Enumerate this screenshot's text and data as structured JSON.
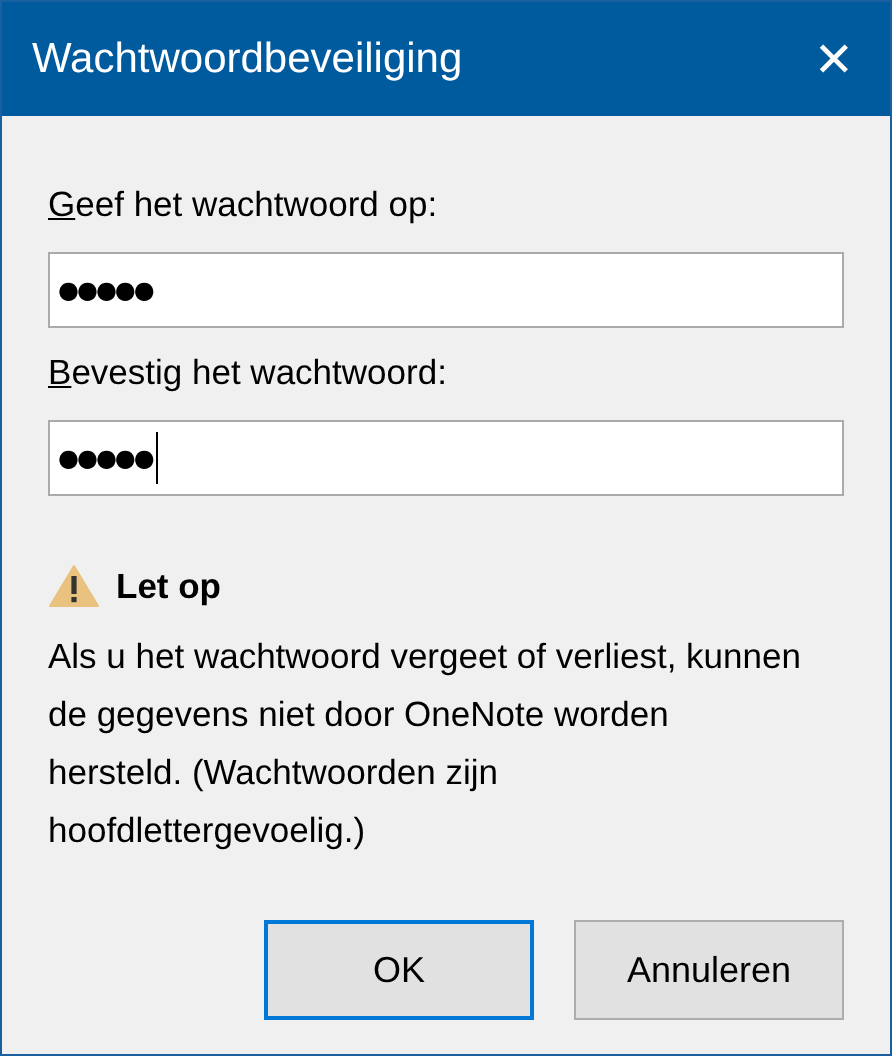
{
  "window": {
    "title": "Wachtwoordbeveiliging",
    "close": "✕"
  },
  "fields": [
    {
      "label": "Geef het wachtwoord op:",
      "mnemonic": true,
      "value": "●●●●●",
      "focused": false
    },
    {
      "label": "Bevestig het wachtwoord:",
      "mnemonic": true,
      "value": "●●●●●",
      "focused": true
    }
  ],
  "warning": {
    "title": "Let op",
    "text": "Als u het wachtwoord vergeet of verliest, kunnen de gegevens niet door OneNote worden hersteld. (Wachtwoorden zijn hoofdlettergevoelig.)"
  },
  "buttons": [
    {
      "label": "OK",
      "default": true
    },
    {
      "label": "Annuleren",
      "default": false
    }
  ]
}
